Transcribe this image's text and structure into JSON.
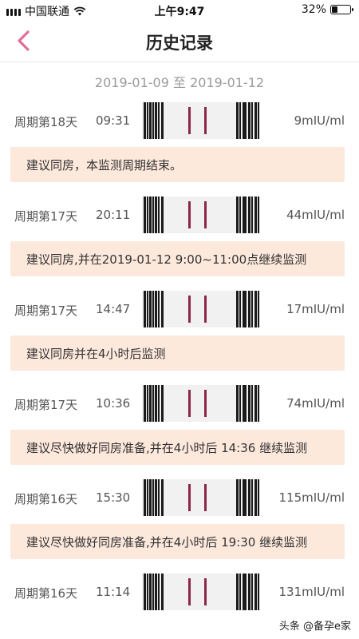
{
  "status_bar": {
    "carrier": "中国联通",
    "time": "上午9:47",
    "battery": "32%",
    "battery_level": 0.32
  },
  "nav": {
    "title": "历史记录"
  },
  "date_range": "2019-01-09 至 2019-01-12",
  "records": [
    {
      "cycle": "周期第18天",
      "time": "09:31",
      "value": "9mIU/ml",
      "advice": "建议同房，本监测周期结束。",
      "lines": 2
    },
    {
      "cycle": "周期第17天",
      "time": "20:11",
      "value": "44mIU/ml",
      "advice": "建议同房,并在2019-01-12 9:00~11:00点继续监测",
      "lines": 2
    },
    {
      "cycle": "周期第17天",
      "time": "14:47",
      "value": "17mIU/ml",
      "advice": "建议同房并在4小时后监测",
      "lines": 2
    },
    {
      "cycle": "周期第17天",
      "time": "10:36",
      "value": "74mIU/ml",
      "advice": "建议尽快做好同房准备,并在4小时后 14:36 继续监测",
      "lines": 2
    },
    {
      "cycle": "周期第16天",
      "time": "15:30",
      "value": "115mIU/ml",
      "advice": "建议尽快做好同房准备,并在4小时后 19:30 继续监测",
      "lines": 2
    },
    {
      "cycle": "周期第16天",
      "time": "11:14",
      "value": "131mIU/ml",
      "advice": null,
      "lines": 2
    }
  ],
  "watermark": "头条 @备孕e家",
  "colors": {
    "accent": "#e36d96",
    "advice_bg": "#fde8dc",
    "strip_line": "#8c2747"
  }
}
